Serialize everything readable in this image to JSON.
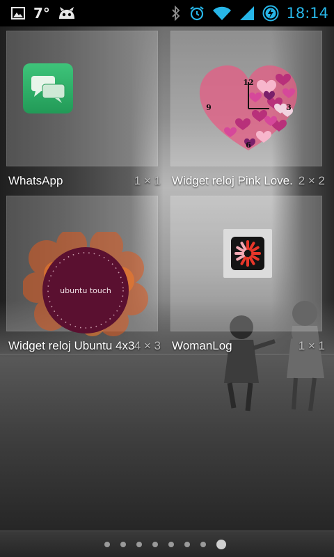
{
  "status_bar": {
    "temperature": "7°",
    "time": "18:14",
    "left_icons": [
      "gallery-icon",
      "cyanogen-mascot-icon"
    ],
    "right_icons": [
      "bluetooth-icon",
      "alarm-clock-icon",
      "wifi-icon",
      "cell-signal-icon",
      "battery-charging-icon"
    ],
    "accent_color": "#27b6e8"
  },
  "widgets": [
    {
      "name": "WhatsApp",
      "size": "1 × 1",
      "icon": "whatsapp-icon"
    },
    {
      "name": "Widget reloj Pink Love.",
      "size": "2 × 2",
      "icon": "pink-heart-clock-icon",
      "clock_numbers": [
        "12",
        "3",
        "6",
        "9"
      ]
    },
    {
      "name": "Widget reloj Ubuntu 4x3",
      "size": "4 × 3",
      "icon": "ubuntu-touch-clock-icon",
      "badge_text": "ubuntu touch"
    },
    {
      "name": "WomanLog",
      "size": "1 × 1",
      "icon": "womanlog-icon"
    }
  ],
  "pager": {
    "total_pages": 8,
    "current_page": 8
  }
}
